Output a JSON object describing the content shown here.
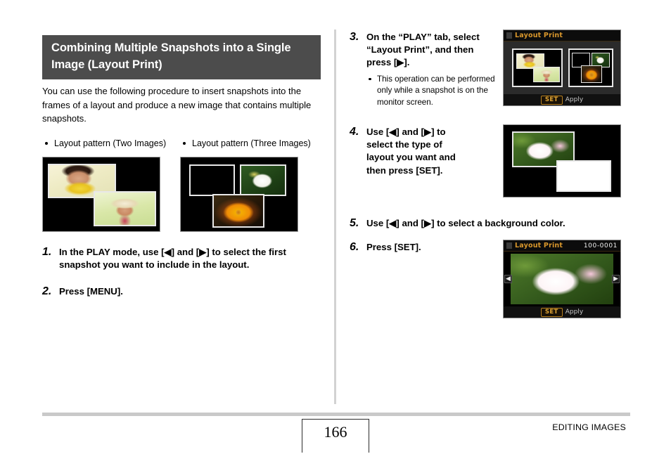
{
  "heading": "Combining Multiple Snapshots into a Single Image (Layout Print)",
  "intro": "You can use the following procedure to insert snapshots into the frames of a layout and produce a new image that contains multiple snapshots.",
  "patterns": [
    {
      "label": "Layout pattern (Two Images)"
    },
    {
      "label": "Layout pattern (Three Images)"
    }
  ],
  "steps": [
    {
      "num": "1.",
      "text": "In the PLAY mode, use [◀] and [▶] to select the first snapshot you want to include in the layout."
    },
    {
      "num": "2.",
      "text": "Press [MENU]."
    },
    {
      "num": "3.",
      "text": "On the “PLAY” tab, select “Layout Print”, and then press [▶].",
      "substep": "This operation can be performed only while a snapshot is on the monitor screen."
    },
    {
      "num": "4.",
      "text": "Use [◀] and [▶] to select the type of layout you want and then press [SET]."
    },
    {
      "num": "5.",
      "text": "Use [◀] and [▶] to select a background color."
    },
    {
      "num": "6.",
      "text": "Press [SET]."
    }
  ],
  "screens": {
    "layout_select": {
      "title": "Layout Print",
      "fileno": "",
      "set_key": "SET",
      "apply_label": "Apply"
    },
    "preview": {
      "title": "Layout Print",
      "fileno": "100-0001",
      "set_key": "SET",
      "apply_label": "Apply",
      "nav_left": "◀",
      "nav_right": "▶"
    }
  },
  "footer": {
    "page_number": "166",
    "section": "EDITING IMAGES"
  },
  "colors": {
    "heading_bar": "#4c4c4c",
    "accent_orange": "#d9972c",
    "divider": "#d2d2d2",
    "footer_rule": "#c9c9c9"
  }
}
